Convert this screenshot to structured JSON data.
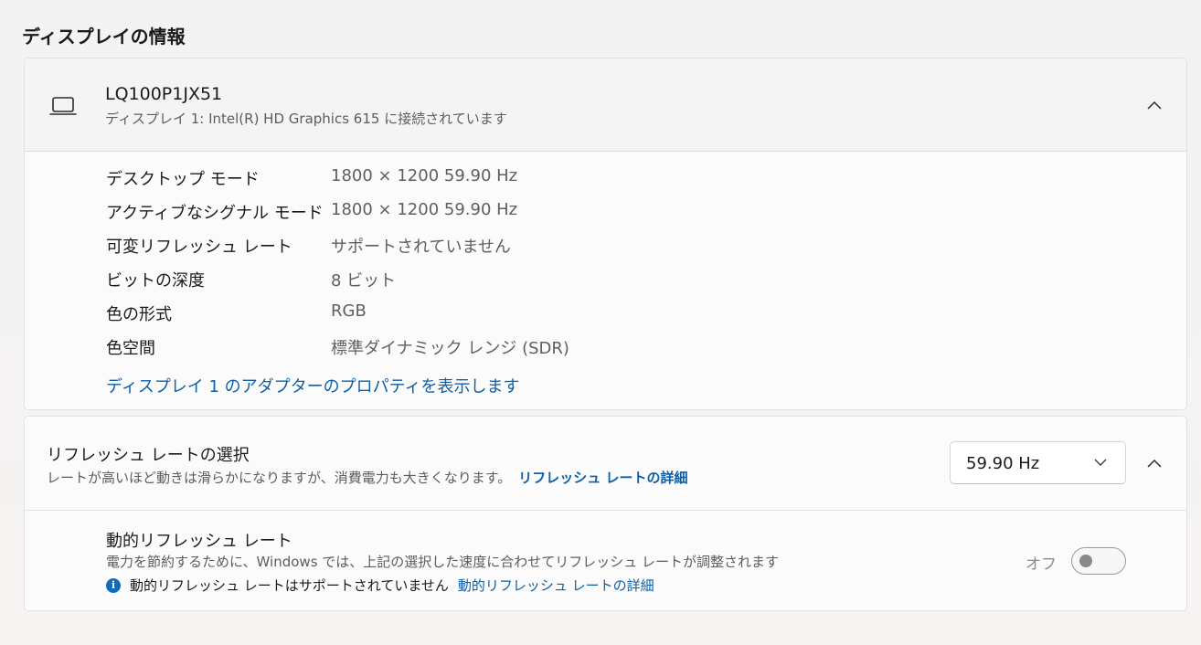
{
  "section": {
    "title": "ディスプレイの情報"
  },
  "display": {
    "icon": "laptop-icon",
    "name": "LQ100P1JX51",
    "subtitle": "ディスプレイ 1: Intel(R) HD Graphics 615 に接続されています",
    "expanded": true,
    "rows": [
      {
        "label": "デスクトップ モード",
        "value": "1800 × 1200 59.90 Hz"
      },
      {
        "label": "アクティブなシグナル モード",
        "value": "1800 × 1200 59.90 Hz"
      },
      {
        "label": "可変リフレッシュ レート",
        "value": "サポートされていません"
      },
      {
        "label": "ビットの深度",
        "value": "8 ビット"
      },
      {
        "label": "色の形式",
        "value": "RGB"
      },
      {
        "label": "色空間",
        "value": "標準ダイナミック レンジ (SDR)"
      }
    ],
    "adapter_link": "ディスプレイ 1 のアダプターのプロパティを表示します"
  },
  "refresh": {
    "title": "リフレッシュ レートの選択",
    "description": "レートが高いほど動きは滑らかになりますが、消費電力も大きくなります。",
    "details_link": "リフレッシュ レートの詳細",
    "selected_rate": "59.90 Hz",
    "expanded": true,
    "dynamic": {
      "title": "動的リフレッシュ レート",
      "description": "電力を節約するために、Windows では、上記の選択した速度に合わせてリフレッシュ レートが調整されます",
      "note": "動的リフレッシュ レートはサポートされていません",
      "note_link": "動的リフレッシュ レートの詳細",
      "toggle_label": "オフ",
      "toggle_on": false
    }
  },
  "colors": {
    "accent_link": "#0f5ea8",
    "info_icon": "#0f6cbd"
  }
}
